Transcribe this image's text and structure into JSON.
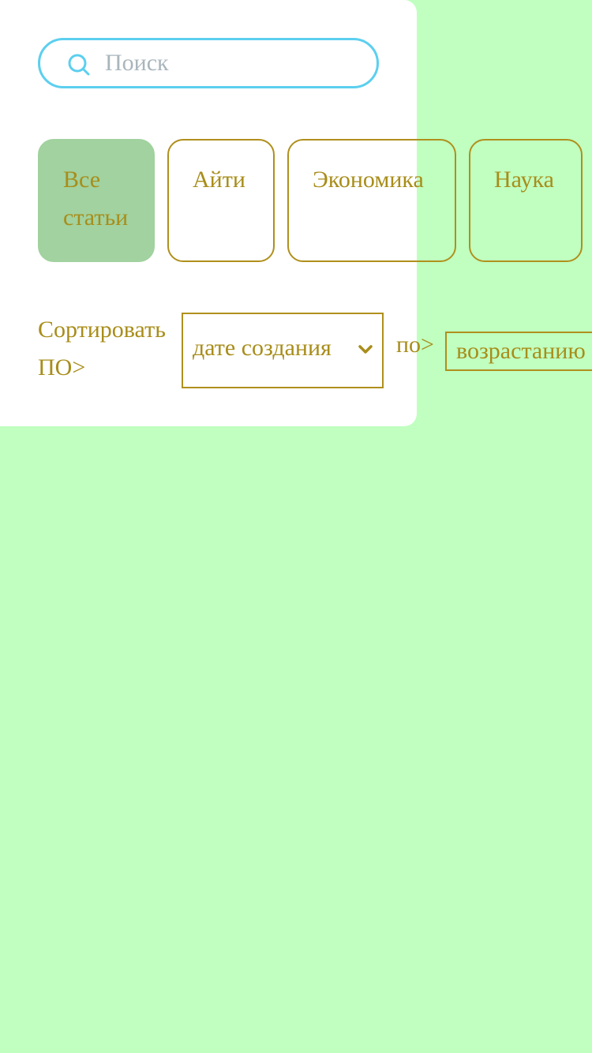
{
  "search": {
    "placeholder": "Поиск",
    "value": "",
    "icon": "search-icon"
  },
  "tabs": [
    {
      "label": "Все статьи",
      "active": true
    },
    {
      "label": "Айти",
      "active": false
    },
    {
      "label": "Экономика",
      "active": false
    },
    {
      "label": "Наука",
      "active": false
    }
  ],
  "sort": {
    "label": "Сортировать ПО>",
    "field_value": "дате создания",
    "po_label": "по>",
    "order_value": "возрастанию"
  },
  "colors": {
    "background": "#c0ffc0",
    "panel": "#ffffff",
    "accent_text": "#a88d1a",
    "search_border": "#5ccfef",
    "active_tab": "#a1d29f"
  }
}
